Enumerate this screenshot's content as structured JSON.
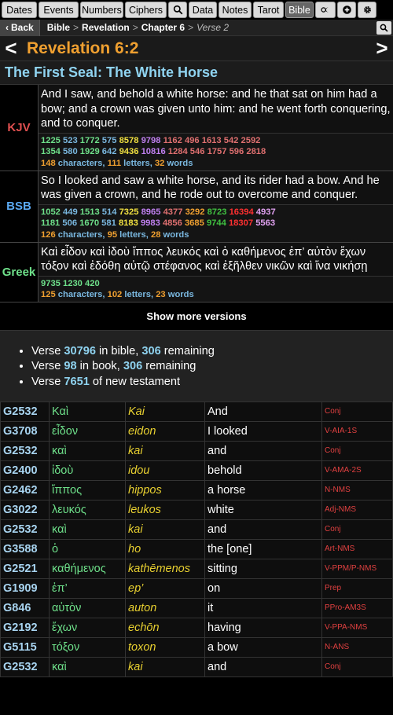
{
  "nav": {
    "tabs": [
      {
        "label": "Dates"
      },
      {
        "label": "Events"
      },
      {
        "label": "Numbers"
      },
      {
        "label": "Ciphers"
      },
      {
        "label": ""
      },
      {
        "label": "Data"
      },
      {
        "label": "Notes"
      },
      {
        "label": "Tarot"
      },
      {
        "label": "Bible"
      },
      {
        "label": ""
      },
      {
        "label": ""
      },
      {
        "label": ""
      }
    ]
  },
  "breadcrumb": {
    "back_label": "Back",
    "items": [
      "Bible",
      "Revelation",
      "Chapter 6"
    ],
    "current": "Verse 2"
  },
  "verse_nav": {
    "title": "Revelation 6:2",
    "prev": "<",
    "next": ">"
  },
  "heading": "The First Seal: The White Horse",
  "versions": [
    {
      "name": "KJV",
      "name_color": "#e05050",
      "text": "And I saw, and behold a white horse: and he that sat on him had a bow; and a crown was given unto him: and he went forth conquering, and to conquer.",
      "nums": [
        [
          {
            "v": "1225",
            "c": "#6ee08a"
          },
          {
            "v": "523",
            "c": "#7ab8e0"
          },
          {
            "v": "1772",
            "c": "#6ee08a"
          },
          {
            "v": "575",
            "c": "#7ab8e0"
          },
          {
            "v": "8578",
            "c": "#f0e040"
          },
          {
            "v": "9798",
            "c": "#c080f0"
          },
          {
            "v": "1162",
            "c": "#e07070"
          },
          {
            "v": "496",
            "c": "#e07070"
          },
          {
            "v": "1613",
            "c": "#e07070"
          },
          {
            "v": "542",
            "c": "#e07070"
          },
          {
            "v": "2592",
            "c": "#e07070"
          }
        ],
        [
          {
            "v": "1354",
            "c": "#6ee08a"
          },
          {
            "v": "580",
            "c": "#7ab8e0"
          },
          {
            "v": "1929",
            "c": "#6ee08a"
          },
          {
            "v": "642",
            "c": "#7ab8e0"
          },
          {
            "v": "9436",
            "c": "#f0e040"
          },
          {
            "v": "10816",
            "c": "#c080f0"
          },
          {
            "v": "1284",
            "c": "#e07070"
          },
          {
            "v": "546",
            "c": "#e07070"
          },
          {
            "v": "1757",
            "c": "#e07070"
          },
          {
            "v": "596",
            "c": "#e07070"
          },
          {
            "v": "2818",
            "c": "#e07070"
          }
        ]
      ],
      "stats": {
        "chars": "148",
        "chars_label": "characters,",
        "letters": "111",
        "letters_label": "letters,",
        "words": "32",
        "words_label": "words"
      }
    },
    {
      "name": "BSB",
      "name_color": "#5aa8f0",
      "text": "So I looked and saw a white horse, and its rider had a bow. And he was given a crown, and he rode out to overcome and conquer.",
      "nums": [
        [
          {
            "v": "1052",
            "c": "#6ee08a"
          },
          {
            "v": "449",
            "c": "#7ab8e0"
          },
          {
            "v": "1513",
            "c": "#6ee08a"
          },
          {
            "v": "514",
            "c": "#7ab8e0"
          },
          {
            "v": "7325",
            "c": "#f0e040"
          },
          {
            "v": "8965",
            "c": "#c080f0"
          },
          {
            "v": "4377",
            "c": "#e07070"
          },
          {
            "v": "3292",
            "c": "#f0a030"
          },
          {
            "v": "8723",
            "c": "#40c040"
          },
          {
            "v": "16394",
            "c": "#ff3030"
          },
          {
            "v": "4937",
            "c": "#e0a0f0"
          }
        ],
        [
          {
            "v": "1181",
            "c": "#6ee08a"
          },
          {
            "v": "506",
            "c": "#7ab8e0"
          },
          {
            "v": "1670",
            "c": "#6ee08a"
          },
          {
            "v": "581",
            "c": "#7ab8e0"
          },
          {
            "v": "8183",
            "c": "#f0e040"
          },
          {
            "v": "9983",
            "c": "#c080f0"
          },
          {
            "v": "4856",
            "c": "#e07070"
          },
          {
            "v": "3685",
            "c": "#f0a030"
          },
          {
            "v": "9744",
            "c": "#40c040"
          },
          {
            "v": "18307",
            "c": "#ff3030"
          },
          {
            "v": "5563",
            "c": "#e0a0f0"
          }
        ]
      ],
      "stats": {
        "chars": "126",
        "chars_label": "characters,",
        "letters": "95",
        "letters_label": "letters,",
        "words": "28",
        "words_label": "words"
      }
    },
    {
      "name": "Greek",
      "name_color": "#6ee08a",
      "text": "Καὶ εἶδον καὶ ἰδοὺ ἵππος λευκός καὶ ὁ καθήμενος ἐπ’ αὐτὸν ἔχων τόξον καὶ ἐδόθη αὐτῷ στέφανος καὶ ἐξῆλθεν νικῶν καὶ ἵνα νικήσῃ",
      "nums": [
        [
          {
            "v": "9735",
            "c": "#6ee08a"
          },
          {
            "v": "1230",
            "c": "#6ee08a"
          },
          {
            "v": "420",
            "c": "#6ee08a"
          }
        ]
      ],
      "stats": {
        "chars": "125",
        "chars_label": "characters,",
        "letters": "102",
        "letters_label": "letters,",
        "words": "23",
        "words_label": "words"
      }
    }
  ],
  "show_more": "Show more versions",
  "positions": [
    {
      "pre": "Verse ",
      "num": "30796",
      "mid": " in bible, ",
      "rem": "306",
      "post": " remaining"
    },
    {
      "pre": "Verse ",
      "num": "98",
      "mid": " in book, ",
      "rem": "306",
      "post": " remaining"
    },
    {
      "pre": "Verse ",
      "num": "7651",
      "mid": " of new testament",
      "rem": "",
      "post": ""
    }
  ],
  "words": [
    [
      "G2532",
      "Καὶ",
      "Kai",
      "And",
      "Conj"
    ],
    [
      "G3708",
      "εἶδον",
      "eidon",
      "I looked",
      "V-AIA-1S"
    ],
    [
      "G2532",
      "καὶ",
      "kai",
      "and",
      "Conj"
    ],
    [
      "G2400",
      "ἰδοὺ",
      "idou",
      "behold",
      "V-AMA-2S"
    ],
    [
      "G2462",
      "ἵππος",
      "hippos",
      "a horse",
      "N-NMS"
    ],
    [
      "G3022",
      "λευκός",
      "leukos",
      "white",
      "Adj-NMS"
    ],
    [
      "G2532",
      "καὶ",
      "kai",
      "and",
      "Conj"
    ],
    [
      "G3588",
      "ὁ",
      "ho",
      "the [one]",
      "Art-NMS"
    ],
    [
      "G2521",
      "καθήμενος",
      "kathēmenos",
      "sitting",
      "V-PPM/P-NMS"
    ],
    [
      "G1909",
      "ἐπ’",
      "ep’",
      "on",
      "Prep"
    ],
    [
      "G846",
      "αὐτὸν",
      "auton",
      "it",
      "PPro-AM3S"
    ],
    [
      "G2192",
      "ἔχων",
      "echōn",
      "having",
      "V-PPA-NMS"
    ],
    [
      "G5115",
      "τόξον",
      "toxon",
      "a bow",
      "N-ANS"
    ],
    [
      "G2532",
      "καὶ",
      "kai",
      "and",
      "Conj"
    ]
  ]
}
